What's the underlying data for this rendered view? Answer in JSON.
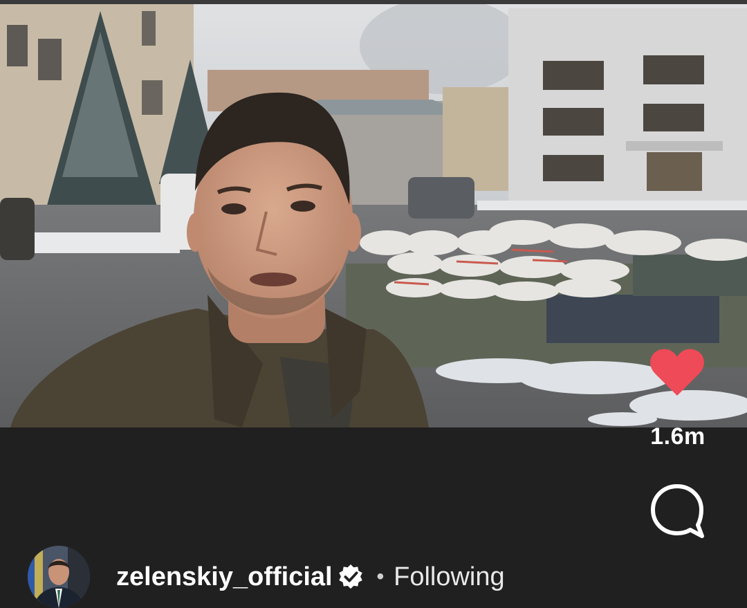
{
  "post": {
    "like_count": "1.6m",
    "author": {
      "username": "zelenskiy_official",
      "verified": true,
      "follow_status": "Following",
      "separator": "•"
    }
  },
  "icons": {
    "like": "heart-icon",
    "comment": "comment-bubble-icon",
    "verified": "verified-badge-icon"
  },
  "colors": {
    "like_active": "#ef4a57",
    "text_primary": "#ffffff",
    "text_secondary": "#e9e9e9",
    "background": "#202020"
  }
}
